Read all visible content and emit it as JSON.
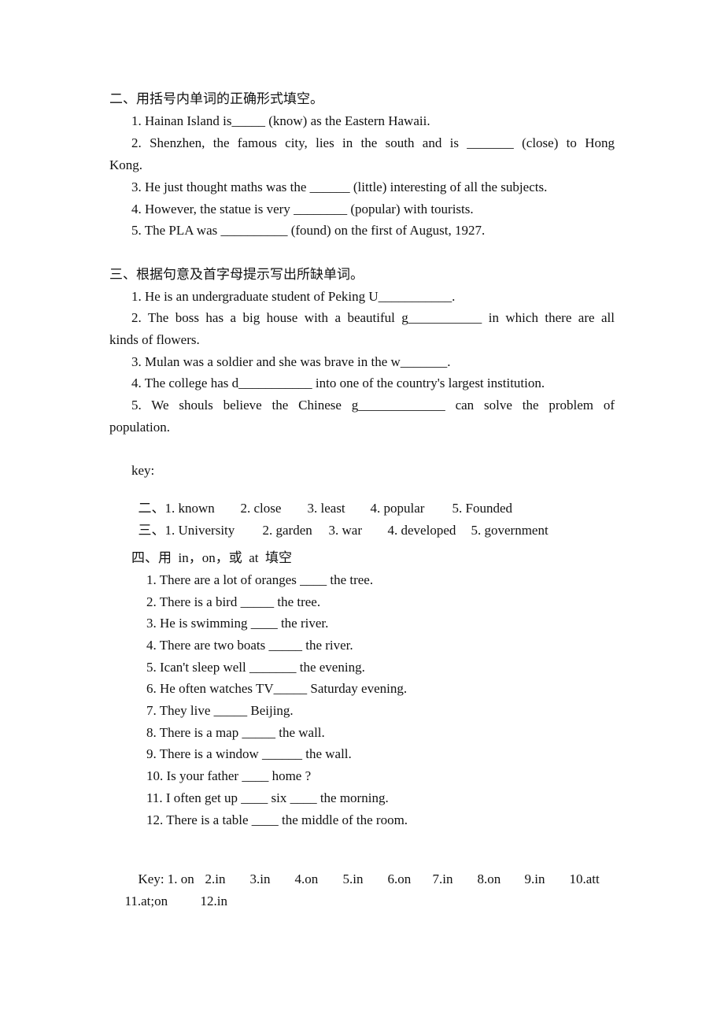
{
  "section2": {
    "heading": "二、用括号内单词的正确形式填空。",
    "items": [
      "1. Hainan Island is_____ (know) as the Eastern Hawaii.",
      "2. Shenzhen, the famous city, lies in the south and is _______ (close) to Hong",
      "Kong.",
      "3. He just thought maths was the ______ (little) interesting of all the subjects.",
      "4. However, the statue is very ________ (popular) with tourists.",
      "5. The PLA was __________ (found) on the first of August, 1927."
    ]
  },
  "section3": {
    "heading": "三、根据句意及首字母提示写出所缺单词。",
    "items": [
      "1. He is an undergraduate student of Peking U___________.",
      "2. The boss has a big house with a beautiful g___________ in which there are all",
      "kinds of flowers.",
      "3. Mulan was a soldier and she was brave in the w_______.",
      "4. The college has d___________ into one of the country's largest institution.",
      "5. We shouls believe the Chinese g_____________ can solve the problem of",
      "population."
    ]
  },
  "key_block": {
    "label": "key:",
    "row2": {
      "prefix": "二、",
      "answers": [
        "1. known",
        "2. close",
        "3. least",
        "4. popular",
        "5. Founded"
      ]
    },
    "row3": {
      "prefix": "三、",
      "answers": [
        "1. University",
        "2. garden",
        "3. war",
        "4. developed",
        "5. government"
      ]
    }
  },
  "section4": {
    "heading": "四、用  in，on，或  at  填空",
    "items": [
      "1. There are a lot of oranges ____ the tree.",
      "2. There is a bird _____ the tree.",
      "3. He is swimming ____ the river.",
      "4. There are two boats _____ the river.",
      "5. Ican't sleep well _______ the evening.",
      "6. He often watches TV_____ Saturday evening.",
      "7. They live _____ Beijing.",
      "8. There is a map _____ the wall.",
      "9. There is a window ______ the wall.",
      "10. Is your father ____ home ?",
      "11. I often get up ____ six ____ the morning.",
      "12. There is a table ____ the middle of the room."
    ]
  },
  "key4": {
    "label": "Key:",
    "answers": [
      "1. on",
      "2.in",
      "3.in",
      "4.on",
      "5.in",
      "6.on",
      "7.in",
      "8.on",
      "9.in",
      "10.att"
    ],
    "answers_line2": [
      "11.at;on",
      "12.in"
    ]
  }
}
